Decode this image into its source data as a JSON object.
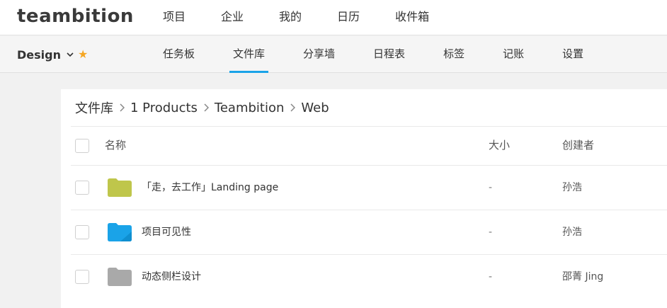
{
  "app": {
    "logo": "teambition"
  },
  "topnav": [
    {
      "label": "项目"
    },
    {
      "label": "企业"
    },
    {
      "label": "我的"
    },
    {
      "label": "日历"
    },
    {
      "label": "收件箱"
    }
  ],
  "project": {
    "name": "Design"
  },
  "tabs": [
    {
      "label": "任务板",
      "active": false
    },
    {
      "label": "文件库",
      "active": true
    },
    {
      "label": "分享墙",
      "active": false
    },
    {
      "label": "日程表",
      "active": false
    },
    {
      "label": "标签",
      "active": false
    },
    {
      "label": "记账",
      "active": false
    },
    {
      "label": "设置",
      "active": false
    }
  ],
  "breadcrumb": [
    "文件库",
    "1 Products",
    "Teambition",
    "Web"
  ],
  "table": {
    "headers": {
      "name": "名称",
      "size": "大小",
      "creator": "创建者"
    },
    "rows": [
      {
        "name": "「走，去工作」Landing page",
        "size": "-",
        "creator": "孙浩",
        "folder_color": "#bfc64b"
      },
      {
        "name": "项目可见性",
        "size": "-",
        "creator": "孙浩",
        "folder_color": "#1aa3e8"
      },
      {
        "name": "动态侧栏设计",
        "size": "-",
        "creator": "邵菁 Jing",
        "folder_color": "#a9a9a9"
      }
    ]
  },
  "colors": {
    "accent": "#1aa3e8",
    "star": "#f5a623"
  }
}
